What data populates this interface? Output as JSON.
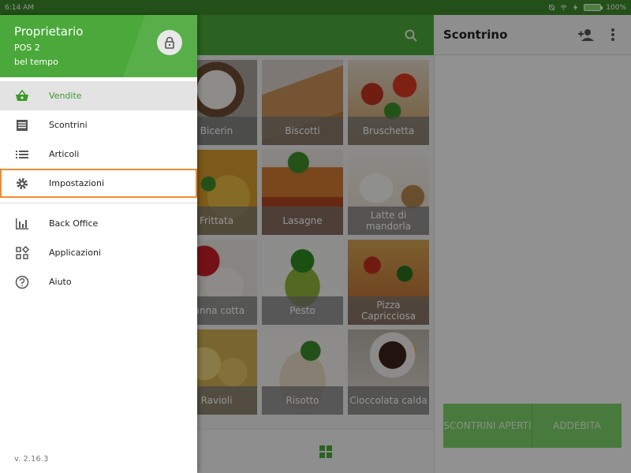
{
  "status_bar": {
    "time": "6:14 AM",
    "battery": "100%"
  },
  "drawer": {
    "owner": "Proprietario",
    "pos": "POS 2",
    "store": "bel tempo",
    "menu": [
      {
        "label": "Vendite",
        "icon": "basket-icon"
      },
      {
        "label": "Scontrini",
        "icon": "receipt-icon"
      },
      {
        "label": "Articoli",
        "icon": "list-icon"
      },
      {
        "label": "Impostazioni",
        "icon": "gear-icon"
      },
      {
        "label": "Back Office",
        "icon": "bar-chart-icon"
      },
      {
        "label": "Applicazioni",
        "icon": "apps-icon"
      },
      {
        "label": "Aiuto",
        "icon": "help-icon"
      }
    ],
    "version": "v. 2.16.3"
  },
  "receipt": {
    "title": "Scontrino",
    "open_receipts_label": "SCONTRINI APERTI",
    "charge_label": "ADDEBITA"
  },
  "items": [
    "Bicerin",
    "Biscotti",
    "Bruschetta",
    "Frittata",
    "Lasagne",
    "Latte di mandorla",
    "Panna cotta",
    "Pesto",
    "Pizza Capricciosa",
    "Ravioli",
    "Risotto",
    "Cioccolata calda"
  ],
  "colors": {
    "brand_green": "#4aa93a",
    "active_text": "#3d9a2c",
    "highlight_border": "#f08a33",
    "charge_button": "#7dd36a"
  }
}
